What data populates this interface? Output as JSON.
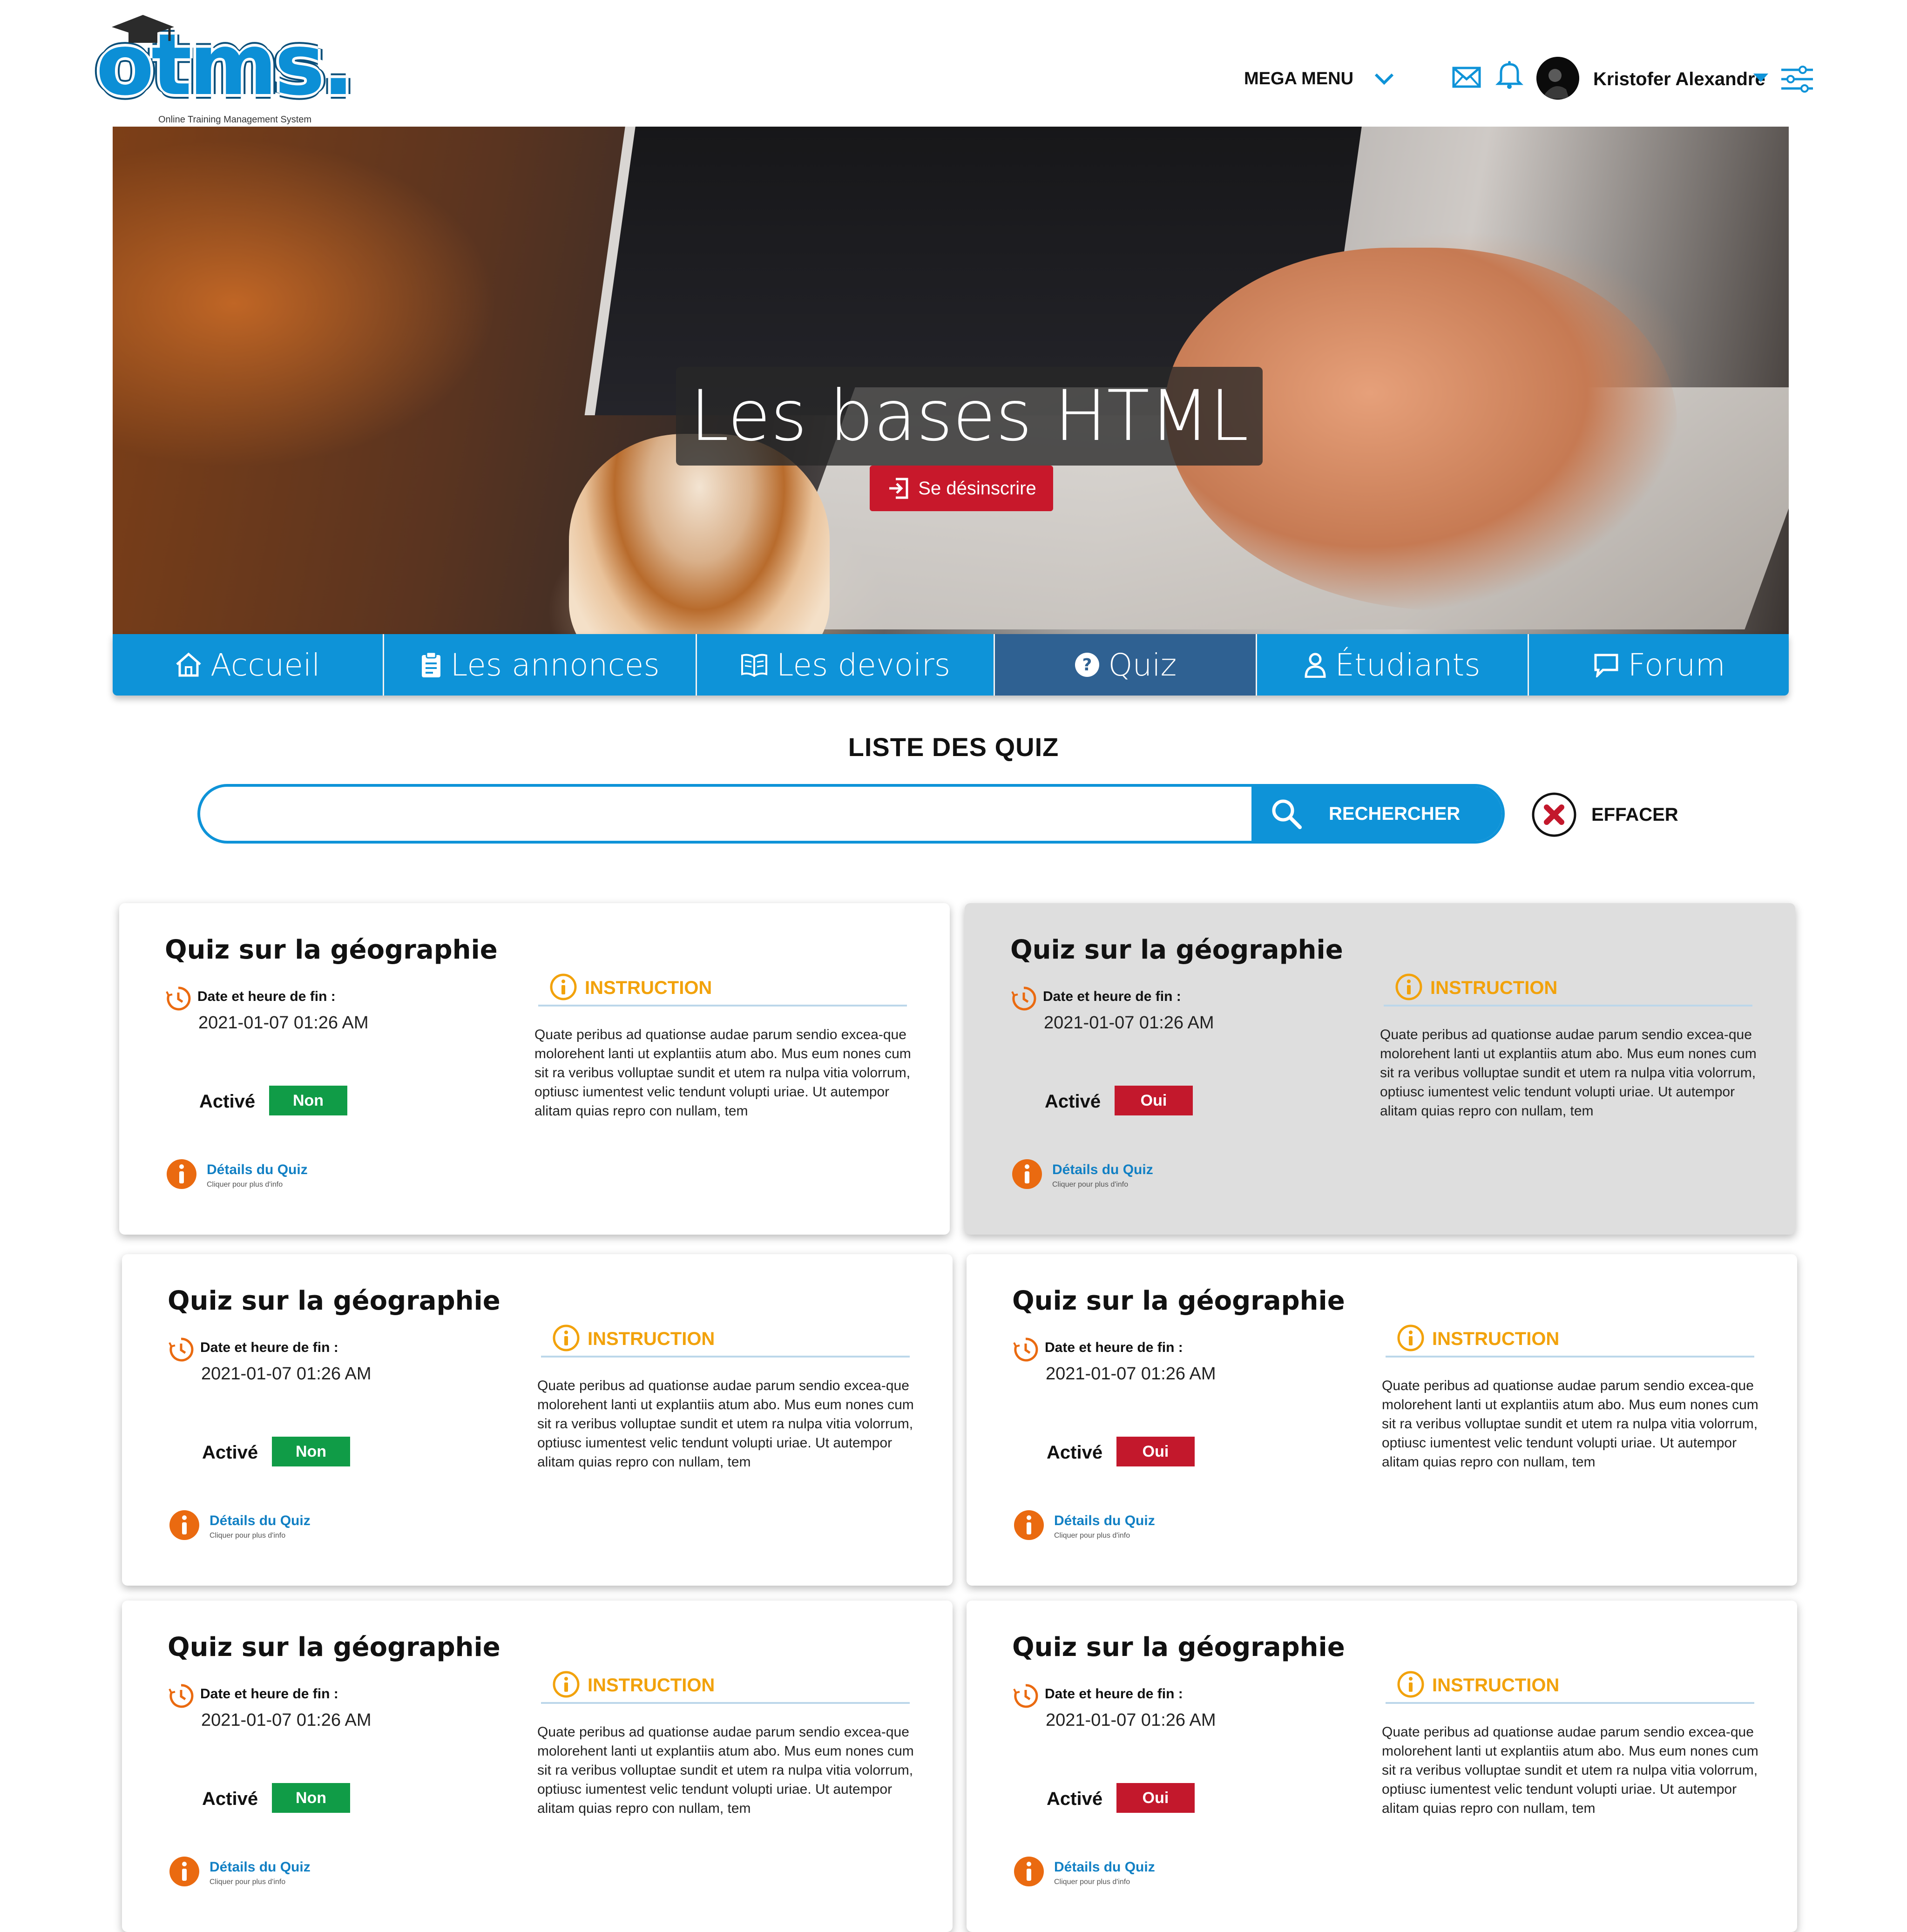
{
  "header": {
    "logo_text": "otms.",
    "logo_subtitle": "Online Training Management System",
    "mega_menu_label": "MEGA MENU",
    "user_name": "Kristofer Alexandre",
    "icons": [
      "mail-icon",
      "bell-icon",
      "avatar",
      "caret-down-icon",
      "settings-sliders-icon"
    ]
  },
  "hero": {
    "title": "Les bases HTML",
    "unsubscribe_label": "Se désinscrire"
  },
  "tabs": [
    {
      "label": "Accueil",
      "icon": "home-icon",
      "active": false
    },
    {
      "label": "Les annonces",
      "icon": "clipboard-icon",
      "active": false
    },
    {
      "label": "Les devoirs",
      "icon": "book-icon",
      "active": false
    },
    {
      "label": "Quiz",
      "icon": "question-icon",
      "active": true
    },
    {
      "label": "Étudiants",
      "icon": "user-icon",
      "active": false
    },
    {
      "label": "Forum",
      "icon": "chat-icon",
      "active": false
    }
  ],
  "list": {
    "title": "LISTE DES QUIZ",
    "search_value": "",
    "search_button": "RECHERCHER",
    "clear_button": "EFFACER"
  },
  "card_labels": {
    "date_label": "Date et heure de fin :",
    "active_label": "Activé",
    "instruction_title": "INSTRUCTION",
    "details_link": "Détails du Quiz",
    "details_sub": "Cliquer pour plus d'info"
  },
  "quizzes": [
    {
      "title": "Quiz sur la géographie",
      "end_date": "2021-01-07 01:26 AM",
      "active": "Non",
      "highlight": false,
      "instruction": "Quate peribus ad quationse audae parum sendio excea-que molorehent lanti ut explantiis atum abo. Mus eum nones cum sit ra veribus volluptae sundit et utem ra nulpa vitia volorrum, optiusc iumentest velic tendunt volupti uriae. Ut autempor alitam quias repro con nullam, tem"
    },
    {
      "title": "Quiz sur la géographie",
      "end_date": "2021-01-07 01:26 AM",
      "active": "Oui",
      "highlight": true,
      "instruction": "Quate peribus ad quationse audae parum sendio excea-que molorehent lanti ut explantiis atum abo. Mus eum nones cum sit ra veribus volluptae sundit et utem ra nulpa vitia volorrum, optiusc iumentest velic tendunt volupti uriae. Ut autempor alitam quias repro con nullam, tem"
    },
    {
      "title": "Quiz sur la géographie",
      "end_date": "2021-01-07 01:26 AM",
      "active": "Non",
      "highlight": false,
      "instruction": "Quate peribus ad quationse audae parum sendio excea-que molorehent lanti ut explantiis atum abo. Mus eum nones cum sit ra veribus volluptae sundit et utem ra nulpa vitia volorrum, optiusc iumentest velic tendunt volupti uriae. Ut autempor alitam quias repro con nullam, tem"
    },
    {
      "title": "Quiz sur la géographie",
      "end_date": "2021-01-07 01:26 AM",
      "active": "Oui",
      "highlight": false,
      "instruction": "Quate peribus ad quationse audae parum sendio excea-que molorehent lanti ut explantiis atum abo. Mus eum nones cum sit ra veribus volluptae sundit et utem ra nulpa vitia volorrum, optiusc iumentest velic tendunt volupti uriae. Ut autempor alitam quias repro con nullam, tem"
    },
    {
      "title": "Quiz sur la géographie",
      "end_date": "2021-01-07 01:26 AM",
      "active": "Non",
      "highlight": false,
      "instruction": "Quate peribus ad quationse audae parum sendio excea-que molorehent lanti ut explantiis atum abo. Mus eum nones cum sit ra veribus volluptae sundit et utem ra nulpa vitia volorrum, optiusc iumentest velic tendunt volupti uriae. Ut autempor alitam quias repro con nullam, tem"
    },
    {
      "title": "Quiz sur la géographie",
      "end_date": "2021-01-07 01:26 AM",
      "active": "Oui",
      "highlight": false,
      "instruction": "Quate peribus ad quationse audae parum sendio excea-que molorehent lanti ut explantiis atum abo. Mus eum nones cum sit ra veribus volluptae sundit et utem ra nulpa vitia volorrum, optiusc iumentest velic tendunt volupti uriae. Ut autempor alitam quias repro con nullam, tem"
    }
  ],
  "colors": {
    "primary": "#0e93d8",
    "active_tab": "#2f6192",
    "danger": "#c3182c",
    "success": "#109c47",
    "instruction": "#f2a20b",
    "accent_orange": "#ea6a10"
  }
}
